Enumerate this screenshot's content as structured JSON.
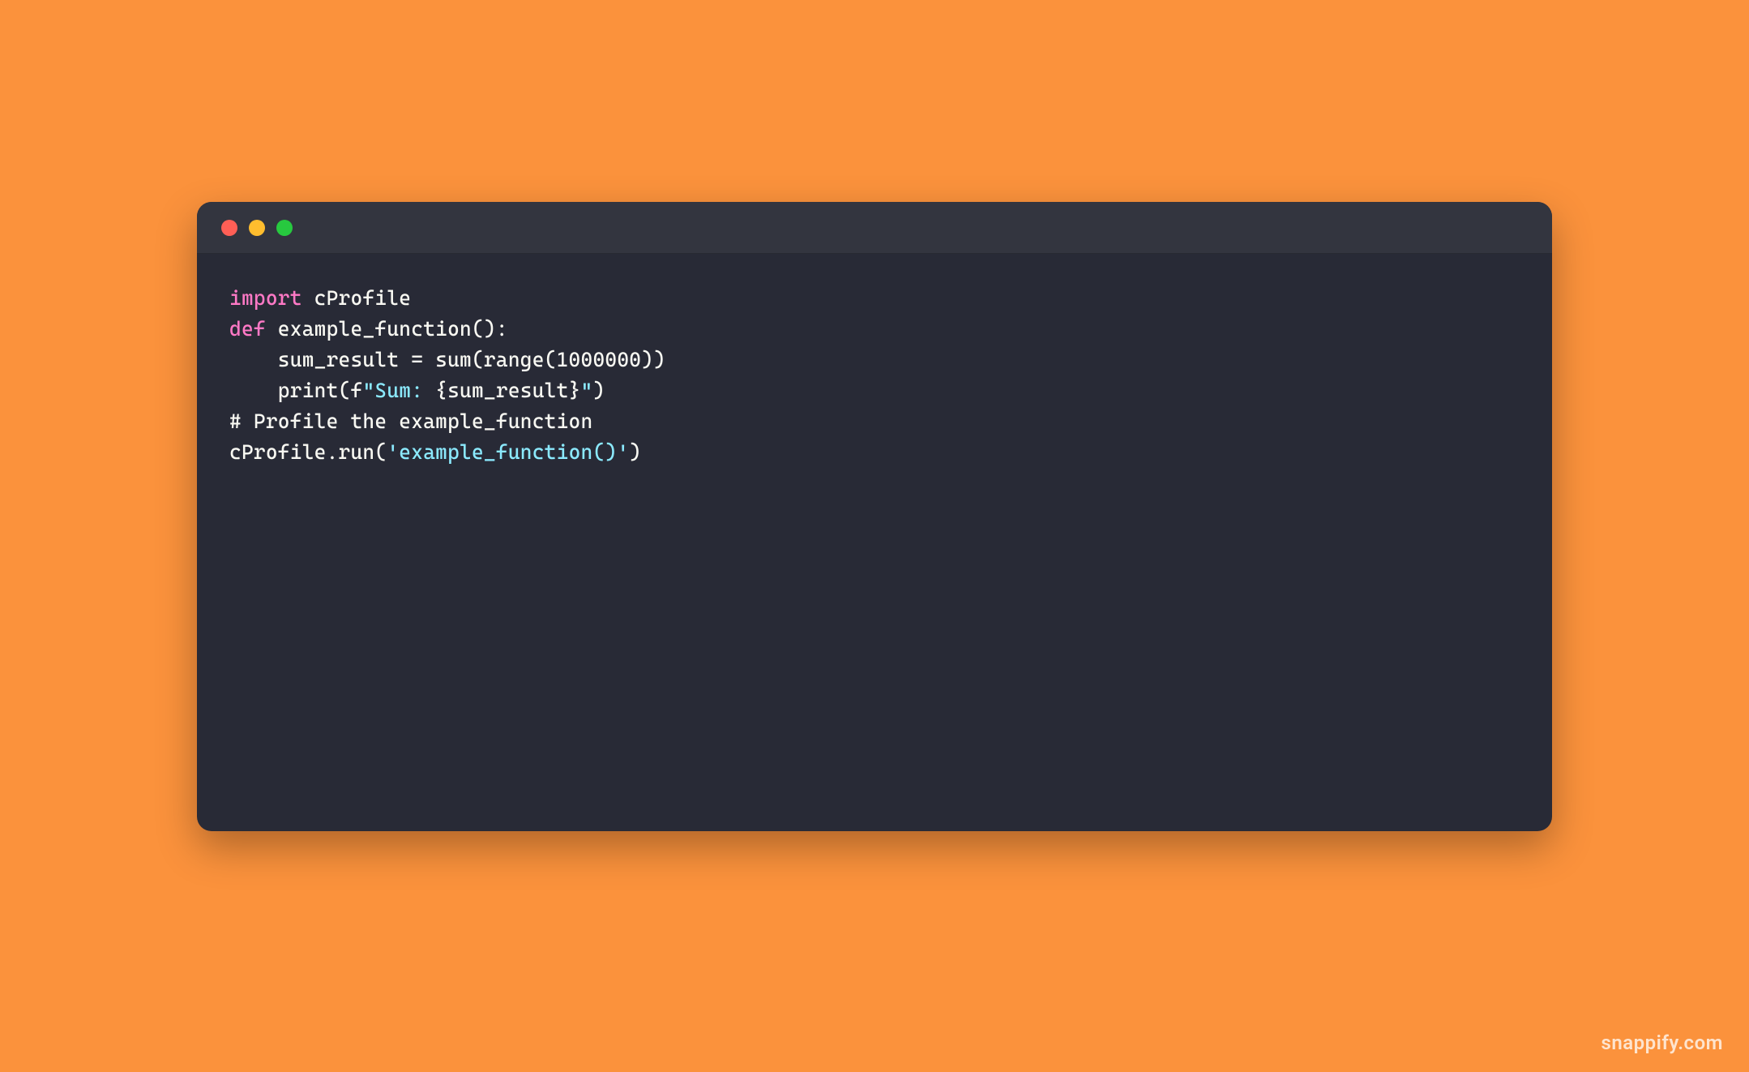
{
  "watermark": "snappify.com",
  "code": {
    "line1": {
      "t1": "import",
      "t2": " cProfile"
    },
    "line2": "",
    "line3": {
      "t1": "def",
      "t2": " example_function():"
    },
    "line4": "    sum_result = sum(range(1000000))",
    "line5": {
      "t1": "    print(f",
      "t2": "\"Sum: ",
      "t3": "{sum_result}",
      "t4": "\"",
      "t5": ")"
    },
    "line6": "",
    "line7": "# Profile the example_function",
    "line8": {
      "t1": "cProfile.run(",
      "t2": "'example_function()'",
      "t3": ")"
    }
  }
}
